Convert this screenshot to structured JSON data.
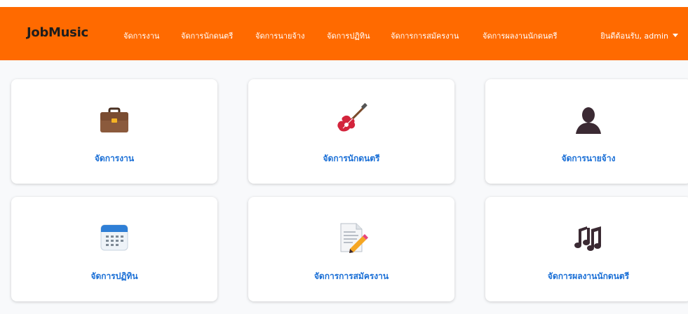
{
  "header": {
    "brand": "JobMusic",
    "nav": [
      "จัดการงาน",
      "จัดการนักดนตรี",
      "จัดการนายจ้าง",
      "จัดการปฏิทิน",
      "จัดการการสมัครงาน",
      "จัดการผลงานนักดนตรี"
    ],
    "user_menu": "ยินดีต้อนรับ, admin"
  },
  "cards": [
    {
      "label": "จัดการงาน",
      "icon": "briefcase-icon"
    },
    {
      "label": "จัดการนักดนตรี",
      "icon": "guitar-icon"
    },
    {
      "label": "จัดการนายจ้าง",
      "icon": "person-icon"
    },
    {
      "label": "จัดการปฏิทิน",
      "icon": "calendar-icon"
    },
    {
      "label": "จัดการการสมัครงาน",
      "icon": "memo-icon"
    },
    {
      "label": "จัดการผลงานนักดนตรี",
      "icon": "musical-notes-icon"
    }
  ],
  "colors": {
    "header_bg": "#ff6a00",
    "link": "#1a6fd6",
    "brand_text": "#1d1d1d"
  }
}
